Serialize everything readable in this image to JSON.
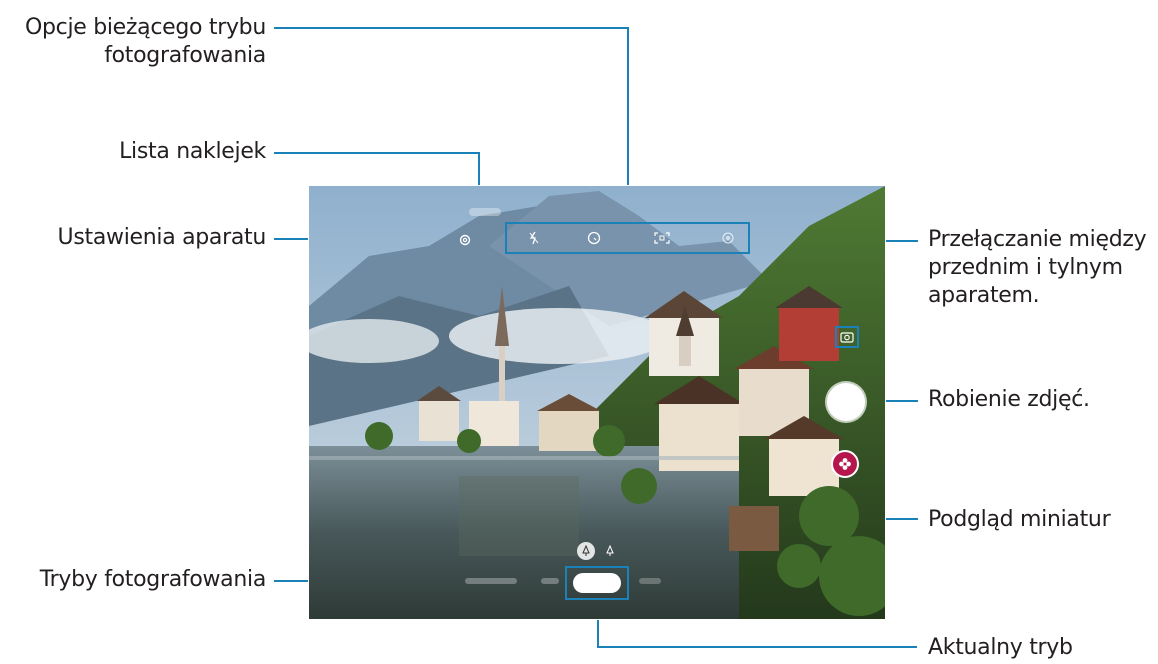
{
  "labels": {
    "shooting_options": "Opcje bieżącego trybu fotografowania",
    "shooting_options_line1": "Opcje bieżącego trybu",
    "shooting_options_line2": "fotografowania",
    "sticker_list": "Lista naklejek",
    "camera_settings": "Ustawienia aparatu",
    "switch_camera_line1": "Przełączanie między",
    "switch_camera_line2": "przednim i tylnym",
    "switch_camera_line3": "aparatem.",
    "take_photo": "Robienie zdjęć.",
    "thumbnail_preview": "Podgląd miniatur",
    "shooting_modes": "Tryby fotografowania",
    "current_mode": "Aktualny tryb"
  },
  "icons": {
    "settings": "gear-icon",
    "flash": "flash-off-icon",
    "timer": "timer-icon",
    "aspect_ratio": "aspect-ratio-icon",
    "filters": "filter-icon",
    "switch_camera": "switch-camera-icon",
    "shutter": "shutter-button",
    "thumbnail": "gallery-thumbnail-icon"
  },
  "colors": {
    "leader": "#1a82b8",
    "thumbnail_bg": "#b5174c",
    "shutter": "#ffffff"
  }
}
